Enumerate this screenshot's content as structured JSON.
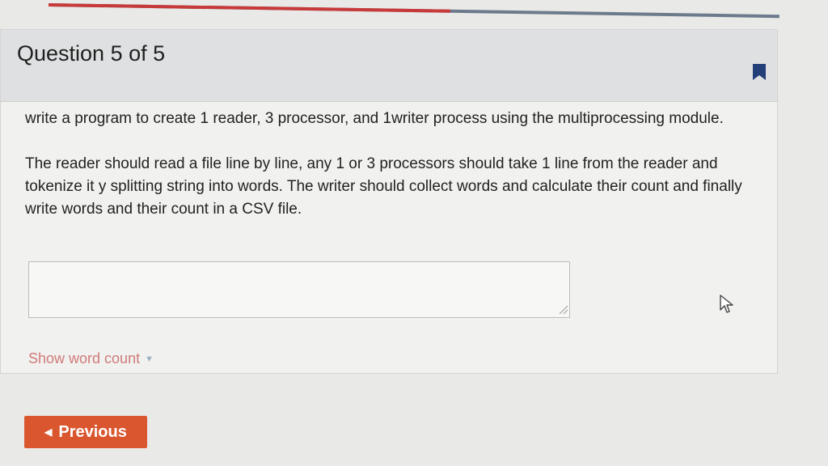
{
  "progress": {
    "fraction": 0.55,
    "fill_color": "#c83a3a",
    "track_color": "#6b7b8c"
  },
  "question": {
    "title": "Question 5 of 5",
    "paragraph_1": "write a program to create 1 reader, 3 processor, and 1writer process using the multiprocessing module.",
    "paragraph_2": "The reader should read a file line by line, any 1 or 3 processors should take 1 line from the reader and tokenize it y splitting string into words. The writer should collect words and calculate their count and finally write words and their count in a CSV file."
  },
  "answer": {
    "value": ""
  },
  "word_count": {
    "label": "Show word count",
    "caret_icon": "caret-down-icon"
  },
  "navigation": {
    "previous_label": "Previous",
    "previous_icon": "chevron-left-icon"
  },
  "icons": {
    "bookmark": "bookmark-icon",
    "cursor": "mouse-cursor-icon",
    "resize": "resize-grip-icon"
  },
  "colors": {
    "accent_button": "#d9562f",
    "word_count_text": "#d07a7a"
  }
}
